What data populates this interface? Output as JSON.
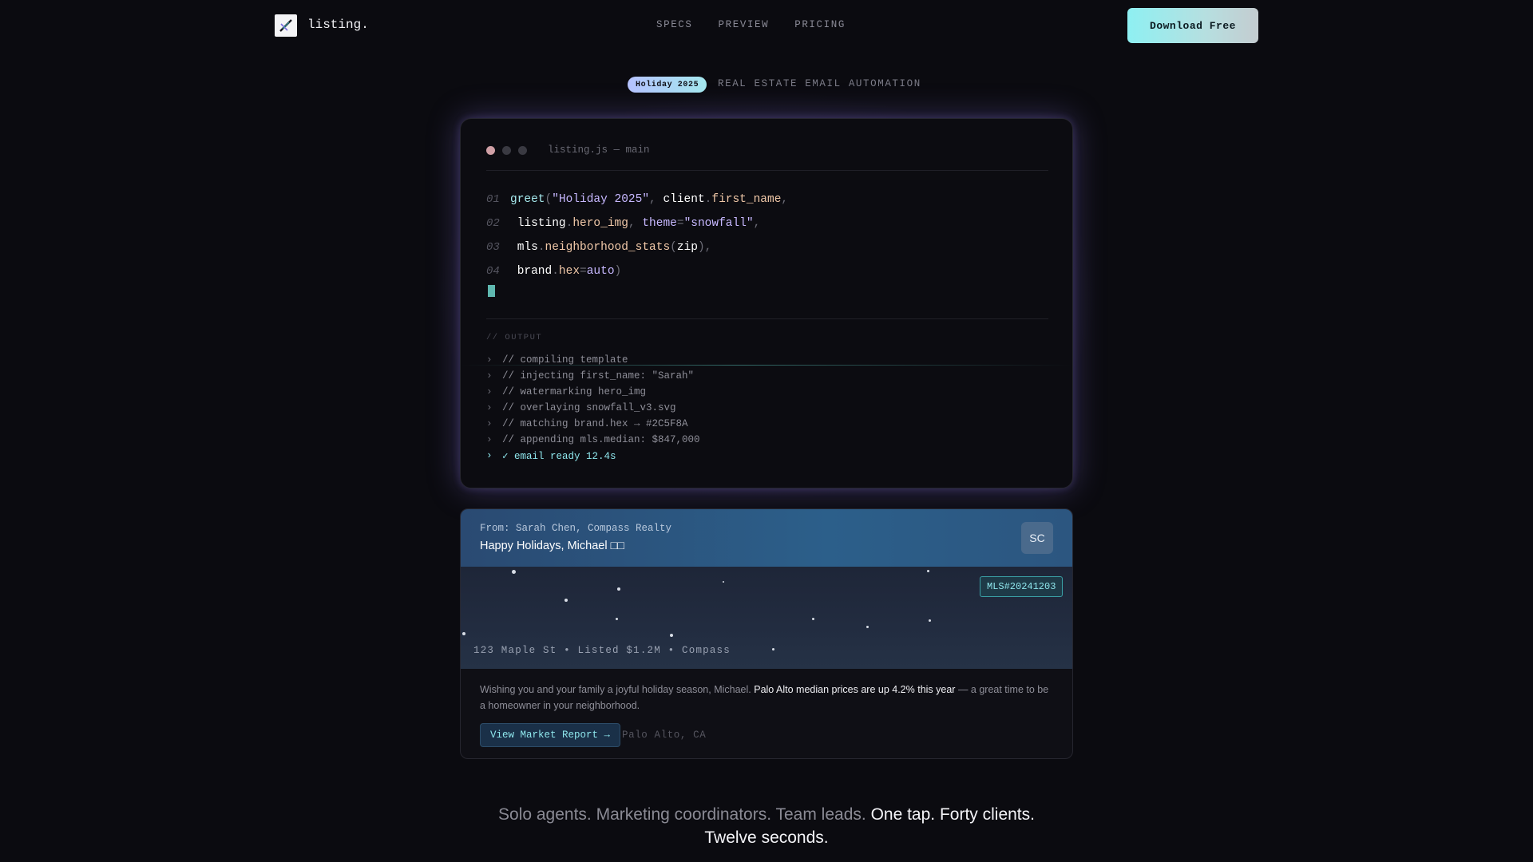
{
  "nav": {
    "logo_text": "listing.",
    "links": [
      "SPECS",
      "PREVIEW",
      "PRICING"
    ],
    "cta_label": "Download Free"
  },
  "hero": {
    "badge": "Holiday 2025",
    "subtitle": "REAL ESTATE EMAIL AUTOMATION"
  },
  "editor": {
    "title": "listing.js — main",
    "line_numbers": [
      "01",
      "02",
      "03",
      "04"
    ],
    "code": {
      "l1_fn": "greet",
      "l1_open": "(",
      "l1_str": "\"Holiday 2025\"",
      "l1_comma": ",",
      "l1_obj": "client",
      "l1_dot": ".",
      "l1_prop": "first_name",
      "l1_end": ",",
      "l2_obj": "listing",
      "l2_dot": ".",
      "l2_prop": "hero_img",
      "l2_comma": ",",
      "l2_kw": "theme",
      "l2_eq": "=",
      "l2_str": "\"snowfall\"",
      "l2_end": ",",
      "l3_obj": "mls",
      "l3_dot": ".",
      "l3_prop": "neighborhood_stats",
      "l3_open": "(",
      "l3_arg": "zip",
      "l3_end": "),",
      "l4_obj": "brand",
      "l4_dot": ".",
      "l4_prop": "hex",
      "l4_eq": "=",
      "l4_val": "auto",
      "l4_end": ")"
    },
    "output_label": "// OUTPUT",
    "output_lines": [
      "// compiling template",
      "// injecting first_name: \"Sarah\"",
      "// watermarking hero_img",
      "// overlaying snowfall_v3.svg",
      "// matching brand.hex → #2C5F8A",
      "// appending mls.median: $847,000"
    ],
    "output_done": "✓ email ready 12.4s",
    "arrow": "›"
  },
  "email": {
    "from": "From: Sarah Chen, Compass Realty",
    "subject": "Happy Holidays, Michael □□",
    "avatar": "SC",
    "mls_badge": "MLS#20241203",
    "hero_caption": "123 Maple St • Listed $1.2M • Compass",
    "body_pre": "Wishing you and your family a joyful holiday season, Michael. ",
    "body_highlight": "Palo Alto median prices are up 4.2% this year",
    "body_post": " — a great time to be a homeowner in your neighborhood.",
    "cta": "View Market Report →",
    "location": "Palo Alto, CA",
    "brand_color": "#2C5F8A"
  },
  "tagline": {
    "muted": "Solo agents. Marketing coordinators. Team leads. ",
    "strong1": "One tap. Forty clients.",
    "strong2": "Twelve seconds."
  }
}
